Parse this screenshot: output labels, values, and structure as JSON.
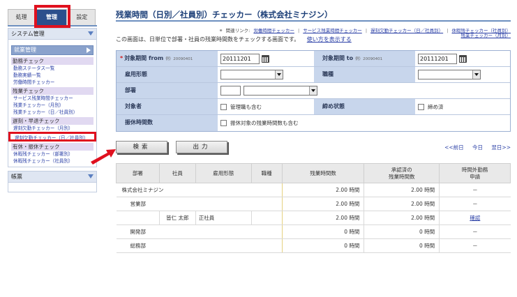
{
  "sidebar": {
    "tabs": [
      "処理",
      "管理",
      "設定"
    ],
    "system_section": "システム管理",
    "work_section": "就業管理",
    "categories": [
      {
        "label": "勤務チェック",
        "links": [
          "勤務ステータス一覧",
          "勤務実績一覧",
          "労働時間チェッカー"
        ]
      },
      {
        "label": "残業チェック",
        "links": [
          "サービス残業時間チェッカー",
          "残業チェッカー（月別）",
          "残業チェッカー（日／社員別）"
        ]
      },
      {
        "label": "遅刻・早退チェック",
        "links": [
          "遅刻欠勤チェッカー（月別）",
          "遅刻欠勤チェッカー（日／社員別）"
        ]
      },
      {
        "label": "有休・振休チェック",
        "links": [
          "休暇残チェッカー（部署別）",
          "休暇残チェッカー（社員別）"
        ]
      }
    ],
    "forms_section": "帳票"
  },
  "main": {
    "title": "残業時間（日別／社員別）チェッカー（株式会社ミナジン）",
    "related_label": "関連リンク:",
    "related_links": [
      "労働時間チェッカー",
      "サービス残業時間チェッカー",
      "遅刻欠勤チェッカー（日／社員別）",
      "休暇残チェッカー（社員別）"
    ],
    "related_link_2": "残業チェッカー（月別）",
    "description": "この画面は、日単位で部署・社員の残業時間数をチェックする画面です。",
    "help_link": "使い方を表示する"
  },
  "form": {
    "period_from_label": "対象期間 from",
    "period_from_example": "例）20090401",
    "period_from_value": "20111201",
    "period_to_label": "対象期間 to",
    "period_to_example": "例）20090401",
    "period_to_value": "20111201",
    "employment_label": "雇用形態",
    "job_label": "職種",
    "department_label": "部署",
    "target_label": "対象者",
    "target_checkbox": "管理職も含む",
    "closing_label": "締め状態",
    "closing_checkbox": "締め済",
    "transfer_label": "振休時間数",
    "transfer_checkbox": "振休対象の残業時間数も含む"
  },
  "actions": {
    "search": "検索",
    "output": "出力",
    "prev": "<<前日",
    "today": "今日",
    "next": "翌日>>"
  },
  "table": {
    "headers": [
      "部署",
      "社員",
      "雇用形態",
      "職種",
      "残業時間数",
      "承認済の\n残業時間数",
      "時間外勤務\n申請"
    ],
    "rows": [
      {
        "dept": "株式会社ミナジン",
        "employee": "",
        "employment": "",
        "job": "",
        "overtime": "2.00 時間",
        "approved": "2.00 時間",
        "request": "－"
      },
      {
        "dept": "営業部",
        "employee": "",
        "employment": "",
        "job": "",
        "overtime": "2.00 時間",
        "approved": "2.00 時間",
        "request": "－"
      },
      {
        "dept": "",
        "employee": "皆仁 太郎",
        "employment": "正社員",
        "job": "",
        "overtime": "2.00 時間",
        "approved": "2.00 時間",
        "request": "確認"
      },
      {
        "dept": "開発部",
        "employee": "",
        "employment": "",
        "job": "",
        "overtime": "0 時間",
        "approved": "0 時間",
        "request": "－"
      },
      {
        "dept": "総務部",
        "employee": "",
        "employment": "",
        "job": "",
        "overtime": "0 時間",
        "approved": "0 時間",
        "request": "－"
      }
    ]
  },
  "colors": {
    "accent": "#2c4f8c",
    "highlight": "#e0101e",
    "label_bg": "#c8d6ec",
    "category_bg": "#e1d9f1"
  }
}
